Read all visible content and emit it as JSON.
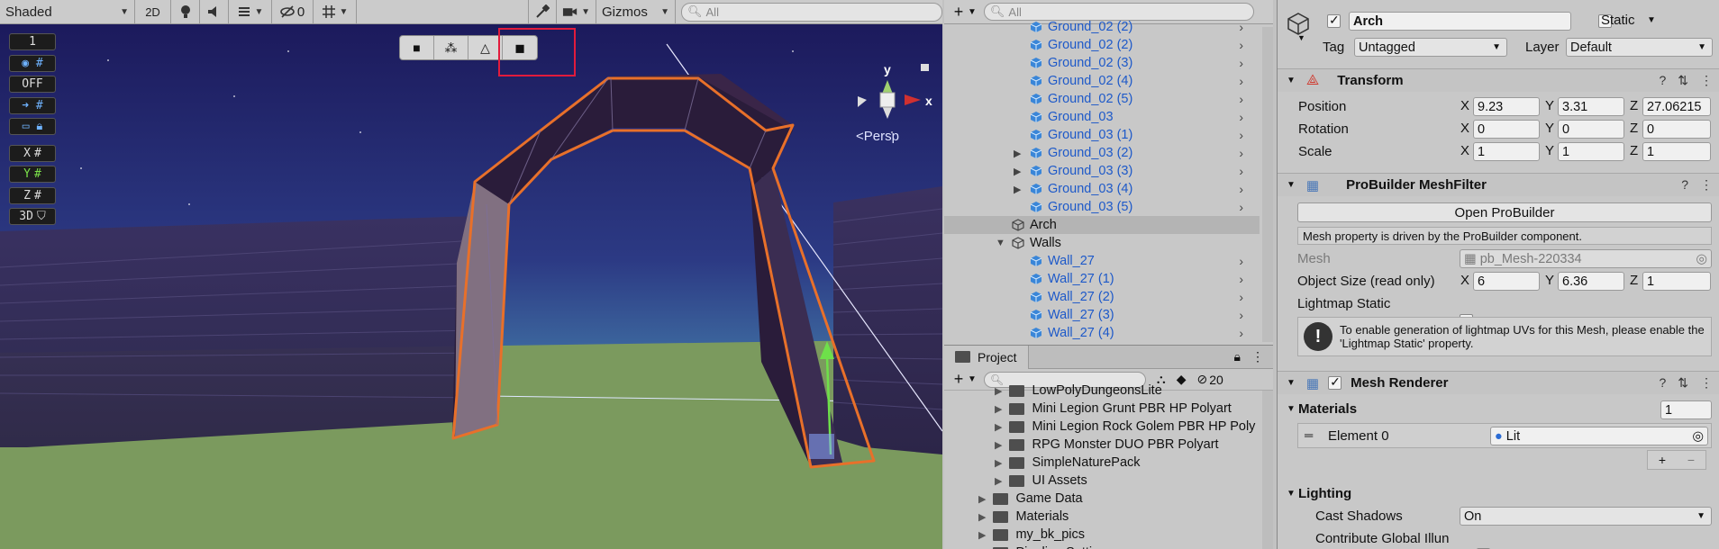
{
  "scene": {
    "shading_mode": "Shaded",
    "mode_2d": "2D",
    "hidden_count": "0",
    "gizmos_label": "Gizmos",
    "search_placeholder": "All",
    "overlay": {
      "camera_speed": "1",
      "toggle_off": "OFF",
      "x_label": "X",
      "y_label": "Y",
      "z_label": "Z",
      "snap3d_label": "3D"
    },
    "axis_labels": {
      "y": "y",
      "x": "x"
    },
    "projection_label": "Persp"
  },
  "hierarchy": {
    "search_placeholder": "All",
    "items": [
      {
        "label": "Ground_02 (2)",
        "prefab": true,
        "expandable": false
      },
      {
        "label": "Ground_02 (2)",
        "prefab": true,
        "expandable": false
      },
      {
        "label": "Ground_02 (3)",
        "prefab": true,
        "expandable": false
      },
      {
        "label": "Ground_02 (4)",
        "prefab": true,
        "expandable": false
      },
      {
        "label": "Ground_02 (5)",
        "prefab": true,
        "expandable": false
      },
      {
        "label": "Ground_03",
        "prefab": true,
        "expandable": false
      },
      {
        "label": "Ground_03 (1)",
        "prefab": true,
        "expandable": false
      },
      {
        "label": "Ground_03 (2)",
        "prefab": true,
        "expandable": true
      },
      {
        "label": "Ground_03 (3)",
        "prefab": true,
        "expandable": true
      },
      {
        "label": "Ground_03 (4)",
        "prefab": true,
        "expandable": true
      },
      {
        "label": "Ground_03 (5)",
        "prefab": true,
        "expandable": false
      },
      {
        "label": "Arch",
        "prefab": false,
        "selected": true
      },
      {
        "label": "Walls",
        "prefab": false,
        "expanded": true
      },
      {
        "label": "Wall_27",
        "prefab": true
      },
      {
        "label": "Wall_27 (1)",
        "prefab": true
      },
      {
        "label": "Wall_27 (2)",
        "prefab": true
      },
      {
        "label": "Wall_27 (3)",
        "prefab": true
      },
      {
        "label": "Wall_27 (4)",
        "prefab": true
      }
    ]
  },
  "project": {
    "tab_label": "Project",
    "hidden_packages_count": "20",
    "folders": [
      {
        "label": "LowPolyDungeonsLite"
      },
      {
        "label": "Mini Legion Grunt PBR HP Polyart"
      },
      {
        "label": "Mini Legion Rock Golem PBR HP Poly"
      },
      {
        "label": "RPG Monster DUO PBR Polyart"
      },
      {
        "label": "SimpleNaturePack"
      },
      {
        "label": "UI Assets"
      },
      {
        "label": "Game Data"
      },
      {
        "label": "Materials"
      },
      {
        "label": "my_bk_pics"
      },
      {
        "label": "Pipeline Settings"
      }
    ]
  },
  "inspector": {
    "object_name": "Arch",
    "static_label": "Static",
    "tag_label": "Tag",
    "tag_value": "Untagged",
    "layer_label": "Layer",
    "layer_value": "Default",
    "transform": {
      "title": "Transform",
      "position_label": "Position",
      "rotation_label": "Rotation",
      "scale_label": "Scale",
      "position": {
        "x": "9.23",
        "y": "3.31",
        "z": "27.06215"
      },
      "rotation": {
        "x": "0",
        "y": "0",
        "z": "0"
      },
      "scale": {
        "x": "1",
        "y": "1",
        "z": "1"
      }
    },
    "axis": {
      "x": "X",
      "y": "Y",
      "z": "Z"
    },
    "meshfilter": {
      "title": "ProBuilder MeshFilter",
      "open_button": "Open ProBuilder",
      "note": "Mesh property is driven by the ProBuilder component.",
      "mesh_label": "Mesh",
      "mesh_value": "pb_Mesh-220334",
      "object_size_label": "Object Size (read only)",
      "object_size": {
        "x": "6",
        "y": "6.36",
        "z": "1"
      },
      "lightmap_static_label": "Lightmap Static",
      "lightmap_info": "To enable generation of lightmap UVs for this Mesh, please enable the 'Lightmap Static' property."
    },
    "mesh_renderer": {
      "title": "Mesh Renderer",
      "materials_label": "Materials",
      "materials_count": "1",
      "element0_label": "Element 0",
      "element0_value": "Lit",
      "add_label": "+",
      "remove_label": "−"
    },
    "lighting": {
      "title": "Lighting",
      "cast_shadows_label": "Cast Shadows",
      "cast_shadows_value": "On",
      "contribute_gi_label": "Contribute Global Illun"
    }
  },
  "colors": {
    "selection_outline": "#e8702a",
    "highlight_box": "#e21b3c",
    "prefab_text": "#1d59c9",
    "sky_top": "#1c1a5c",
    "ground": "#7a9860"
  }
}
